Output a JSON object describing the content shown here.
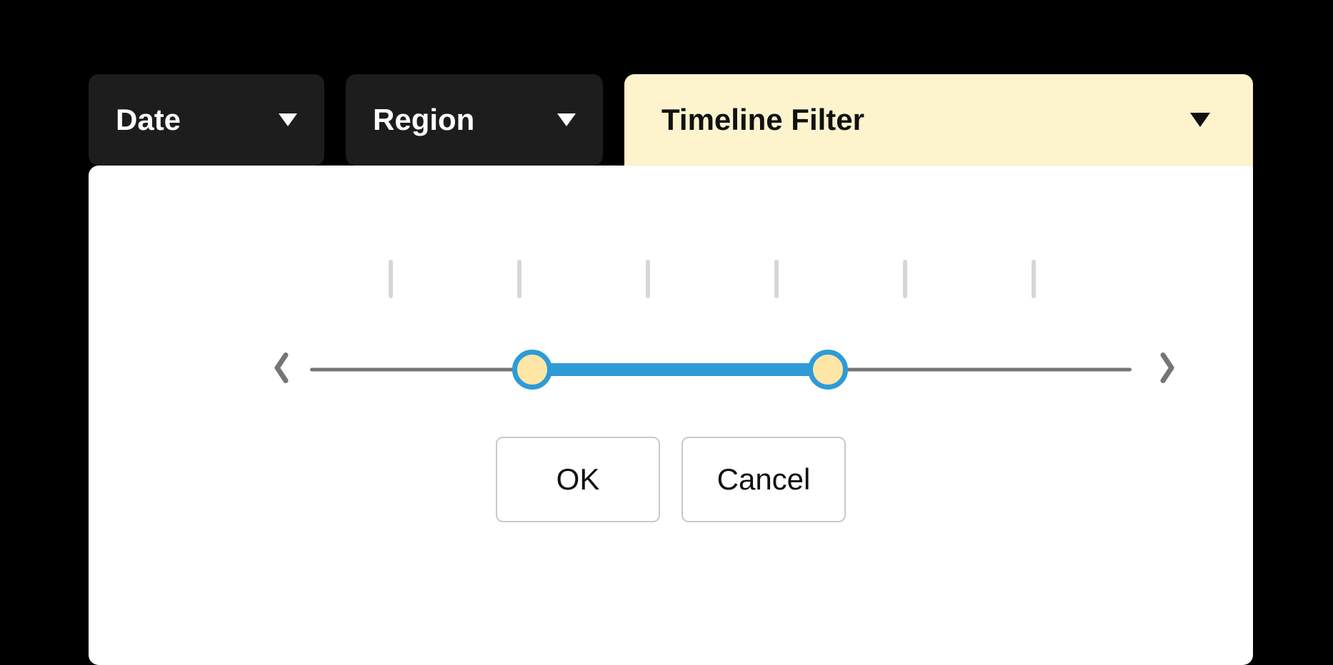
{
  "filters": {
    "date": {
      "label": "Date"
    },
    "region": {
      "label": "Region"
    },
    "timeline": {
      "label": "Timeline Filter",
      "active": true
    }
  },
  "timeline": {
    "tick_count": 6,
    "range_start_pct": 27,
    "range_end_pct": 63
  },
  "buttons": {
    "ok": "OK",
    "cancel": "Cancel"
  },
  "colors": {
    "accent_blue": "#2e9bd6",
    "handle_fill": "#ffe6a7",
    "active_chip_bg": "#fdf4ce",
    "dark_chip_bg": "#1d1d1d",
    "tick": "#d6d6d6",
    "track": "#757575"
  }
}
